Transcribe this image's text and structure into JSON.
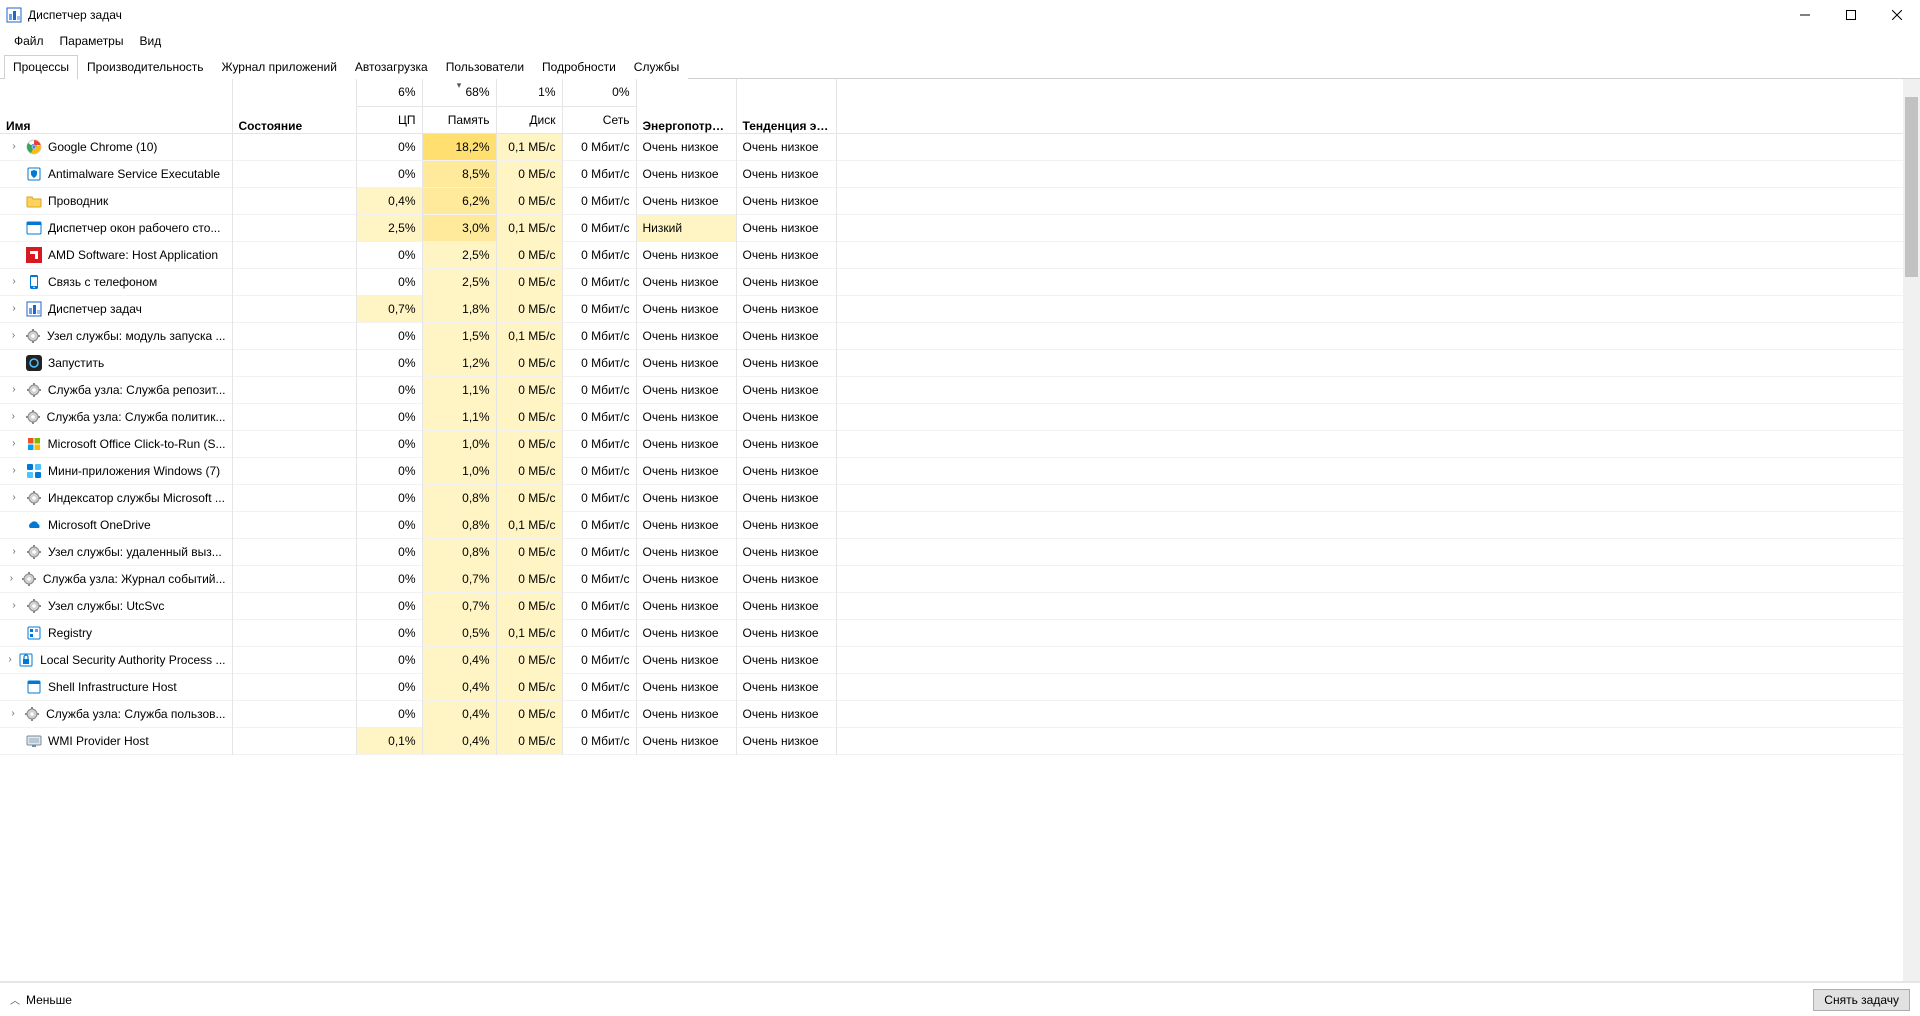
{
  "window": {
    "title": "Диспетчер задач"
  },
  "menubar": [
    "Файл",
    "Параметры",
    "Вид"
  ],
  "tabs": [
    "Процессы",
    "Производительность",
    "Журнал приложений",
    "Автозагрузка",
    "Пользователи",
    "Подробности",
    "Службы"
  ],
  "active_tab_index": 0,
  "columns": {
    "name": "Имя",
    "state": "Состояние",
    "cpu_pct": "6%",
    "cpu_label": "ЦП",
    "mem_pct": "68%",
    "mem_label": "Память",
    "disk_pct": "1%",
    "disk_label": "Диск",
    "net_pct": "0%",
    "net_label": "Сеть",
    "power": "Энергопотреб...",
    "power_trend": "Тенденция эн..."
  },
  "rows": [
    {
      "exp": true,
      "icon": "chrome",
      "name": "Google Chrome (10)",
      "cpu": "0%",
      "cpu_h": 0,
      "mem": "18,2%",
      "mem_h": 3,
      "disk": "0,1 МБ/c",
      "disk_h": 1,
      "net": "0 Мбит/с",
      "power": "Очень низкое",
      "trend": "Очень низкое"
    },
    {
      "exp": false,
      "icon": "shield",
      "name": "Antimalware Service Executable",
      "cpu": "0%",
      "cpu_h": 0,
      "mem": "8,5%",
      "mem_h": 2,
      "disk": "0 МБ/c",
      "disk_h": 1,
      "net": "0 Мбит/с",
      "power": "Очень низкое",
      "trend": "Очень низкое"
    },
    {
      "exp": false,
      "icon": "folder",
      "name": "Проводник",
      "cpu": "0,4%",
      "cpu_h": 1,
      "mem": "6,2%",
      "mem_h": 2,
      "disk": "0 МБ/c",
      "disk_h": 1,
      "net": "0 Мбит/с",
      "power": "Очень низкое",
      "trend": "Очень низкое"
    },
    {
      "exp": false,
      "icon": "dwm",
      "name": "Диспетчер окон рабочего сто...",
      "cpu": "2,5%",
      "cpu_h": 1,
      "mem": "3,0%",
      "mem_h": 2,
      "disk": "0,1 МБ/c",
      "disk_h": 1,
      "net": "0 Мбит/с",
      "power": "Низкий",
      "power_h": 1,
      "trend": "Очень низкое"
    },
    {
      "exp": false,
      "icon": "amd",
      "name": "AMD Software: Host Application",
      "cpu": "0%",
      "cpu_h": 0,
      "mem": "2,5%",
      "mem_h": 1,
      "disk": "0 МБ/c",
      "disk_h": 1,
      "net": "0 Мбит/с",
      "power": "Очень низкое",
      "trend": "Очень низкое"
    },
    {
      "exp": true,
      "icon": "phone",
      "name": "Связь с телефоном",
      "cpu": "0%",
      "cpu_h": 0,
      "mem": "2,5%",
      "mem_h": 1,
      "disk": "0 МБ/c",
      "disk_h": 1,
      "net": "0 Мбит/с",
      "power": "Очень низкое",
      "trend": "Очень низкое"
    },
    {
      "exp": true,
      "icon": "taskmgr",
      "name": "Диспетчер задач",
      "cpu": "0,7%",
      "cpu_h": 1,
      "mem": "1,8%",
      "mem_h": 1,
      "disk": "0 МБ/c",
      "disk_h": 1,
      "net": "0 Мбит/с",
      "power": "Очень низкое",
      "trend": "Очень низкое"
    },
    {
      "exp": true,
      "icon": "gear",
      "name": "Узел службы: модуль запуска ...",
      "cpu": "0%",
      "cpu_h": 0,
      "mem": "1,5%",
      "mem_h": 1,
      "disk": "0,1 МБ/c",
      "disk_h": 1,
      "net": "0 Мбит/с",
      "power": "Очень низкое",
      "trend": "Очень низкое"
    },
    {
      "exp": false,
      "icon": "cortana",
      "name": "Запустить",
      "cpu": "0%",
      "cpu_h": 0,
      "mem": "1,2%",
      "mem_h": 1,
      "disk": "0 МБ/c",
      "disk_h": 1,
      "net": "0 Мбит/с",
      "power": "Очень низкое",
      "trend": "Очень низкое"
    },
    {
      "exp": true,
      "icon": "gear",
      "name": "Служба узла: Служба репозит...",
      "cpu": "0%",
      "cpu_h": 0,
      "mem": "1,1%",
      "mem_h": 1,
      "disk": "0 МБ/c",
      "disk_h": 1,
      "net": "0 Мбит/с",
      "power": "Очень низкое",
      "trend": "Очень низкое"
    },
    {
      "exp": true,
      "icon": "gear",
      "name": "Служба узла: Служба политик...",
      "cpu": "0%",
      "cpu_h": 0,
      "mem": "1,1%",
      "mem_h": 1,
      "disk": "0 МБ/c",
      "disk_h": 1,
      "net": "0 Мбит/с",
      "power": "Очень низкое",
      "trend": "Очень низкое"
    },
    {
      "exp": true,
      "icon": "office",
      "name": "Microsoft Office Click-to-Run (S...",
      "cpu": "0%",
      "cpu_h": 0,
      "mem": "1,0%",
      "mem_h": 1,
      "disk": "0 МБ/c",
      "disk_h": 1,
      "net": "0 Мбит/с",
      "power": "Очень низкое",
      "trend": "Очень низкое"
    },
    {
      "exp": true,
      "icon": "widgets",
      "name": "Мини-приложения Windows (7)",
      "cpu": "0%",
      "cpu_h": 0,
      "mem": "1,0%",
      "mem_h": 1,
      "disk": "0 МБ/c",
      "disk_h": 1,
      "net": "0 Мбит/с",
      "power": "Очень низкое",
      "trend": "Очень низкое"
    },
    {
      "exp": true,
      "icon": "gear",
      "name": "Индексатор службы Microsoft ...",
      "cpu": "0%",
      "cpu_h": 0,
      "mem": "0,8%",
      "mem_h": 1,
      "disk": "0 МБ/c",
      "disk_h": 1,
      "net": "0 Мбит/с",
      "power": "Очень низкое",
      "trend": "Очень низкое"
    },
    {
      "exp": false,
      "icon": "onedrive",
      "name": "Microsoft OneDrive",
      "cpu": "0%",
      "cpu_h": 0,
      "mem": "0,8%",
      "mem_h": 1,
      "disk": "0,1 МБ/c",
      "disk_h": 1,
      "net": "0 Мбит/с",
      "power": "Очень низкое",
      "trend": "Очень низкое"
    },
    {
      "exp": true,
      "icon": "gear",
      "name": "Узел службы: удаленный выз...",
      "cpu": "0%",
      "cpu_h": 0,
      "mem": "0,8%",
      "mem_h": 1,
      "disk": "0 МБ/c",
      "disk_h": 1,
      "net": "0 Мбит/с",
      "power": "Очень низкое",
      "trend": "Очень низкое"
    },
    {
      "exp": true,
      "icon": "gear",
      "name": "Служба узла: Журнал событий...",
      "cpu": "0%",
      "cpu_h": 0,
      "mem": "0,7%",
      "mem_h": 1,
      "disk": "0 МБ/c",
      "disk_h": 1,
      "net": "0 Мбит/с",
      "power": "Очень низкое",
      "trend": "Очень низкое"
    },
    {
      "exp": true,
      "icon": "gear",
      "name": "Узел службы: UtcSvc",
      "cpu": "0%",
      "cpu_h": 0,
      "mem": "0,7%",
      "mem_h": 1,
      "disk": "0 МБ/c",
      "disk_h": 1,
      "net": "0 Мбит/с",
      "power": "Очень низкое",
      "trend": "Очень низкое"
    },
    {
      "exp": false,
      "icon": "registry",
      "name": "Registry",
      "cpu": "0%",
      "cpu_h": 0,
      "mem": "0,5%",
      "mem_h": 1,
      "disk": "0,1 МБ/c",
      "disk_h": 1,
      "net": "0 Мбит/с",
      "power": "Очень низкое",
      "trend": "Очень низкое"
    },
    {
      "exp": true,
      "icon": "lsass",
      "name": "Local Security Authority Process ...",
      "cpu": "0%",
      "cpu_h": 0,
      "mem": "0,4%",
      "mem_h": 1,
      "disk": "0 МБ/c",
      "disk_h": 1,
      "net": "0 Мбит/с",
      "power": "Очень низкое",
      "trend": "Очень низкое"
    },
    {
      "exp": false,
      "icon": "shell",
      "name": "Shell Infrastructure Host",
      "cpu": "0%",
      "cpu_h": 0,
      "mem": "0,4%",
      "mem_h": 1,
      "disk": "0 МБ/c",
      "disk_h": 1,
      "net": "0 Мбит/с",
      "power": "Очень низкое",
      "trend": "Очень низкое"
    },
    {
      "exp": true,
      "icon": "gear",
      "name": "Служба узла: Служба пользов...",
      "cpu": "0%",
      "cpu_h": 0,
      "mem": "0,4%",
      "mem_h": 1,
      "disk": "0 МБ/c",
      "disk_h": 1,
      "net": "0 Мбит/с",
      "power": "Очень низкое",
      "trend": "Очень низкое"
    },
    {
      "exp": false,
      "icon": "wmi",
      "name": "WMI Provider Host",
      "cpu": "0,1%",
      "cpu_h": 1,
      "mem": "0,4%",
      "mem_h": 1,
      "disk": "0 МБ/c",
      "disk_h": 1,
      "net": "0 Мбит/с",
      "power": "Очень низкое",
      "trend": "Очень низкое"
    }
  ],
  "footer": {
    "less": "Меньше",
    "end_task": "Снять задачу"
  }
}
